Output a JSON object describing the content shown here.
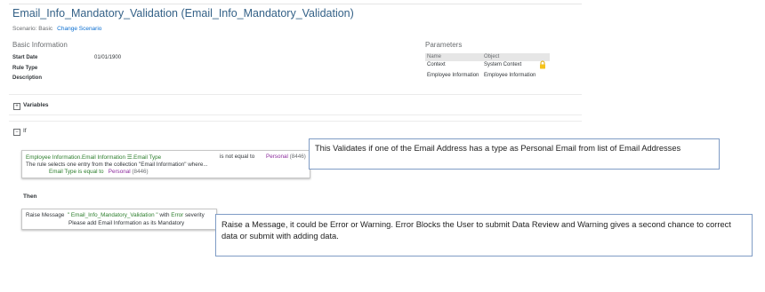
{
  "header": {
    "title": "Email_Info_Mandatory_Validation (Email_Info_Mandatory_Validation)",
    "scenario_label": "Scenario: Basic",
    "change_scenario": "Change Scenario"
  },
  "basic_info": {
    "heading": "Basic Information",
    "fields": [
      {
        "label": "Start Date",
        "value": "01/01/1900"
      },
      {
        "label": "Rule Type",
        "value": ""
      },
      {
        "label": "Description",
        "value": ""
      }
    ]
  },
  "parameters": {
    "heading": "Parameters",
    "columns": [
      "Name",
      "Object"
    ],
    "rows": [
      {
        "name": "Context",
        "object": "System Context",
        "icon": "lock-icon"
      },
      {
        "name": "Employee Information",
        "object": "Employee Information"
      }
    ]
  },
  "variables": {
    "toggle": "+",
    "label": "Variables"
  },
  "if_section": {
    "toggle": "−",
    "label": "If",
    "condition": {
      "field": "Employee Information.Email Information ☰.Email Type",
      "operator": "is not equal to",
      "value": "Personal",
      "value_id": "(8446)",
      "description": "The rule selects one entry from the collection \"Email Information\" where...",
      "sub_field": "Email Type is equal to",
      "sub_value": "Personal",
      "sub_value_id": "(8446)"
    }
  },
  "then_section": {
    "label": "Then",
    "action": "Raise Message",
    "message_name": "\" Email_Info_Mandatory_Validation \"",
    "with_text": "with",
    "severity": "Error",
    "severity_suffix": "severity",
    "message_text": "Please add Email Information as its Mandatory"
  },
  "annotations": {
    "note1": "This Validates if one of the Email Address has a type as Personal Email from list of Email Addresses",
    "note2": "Raise a Message, it could be Error or Warning. Error Blocks the User to submit Data Review and Warning gives a second chance to correct data or submit with adding data."
  },
  "colors": {
    "title": "#346187",
    "link": "#0a6ed1",
    "field_green": "#2b7d2b",
    "value_purple": "#8b2a9c",
    "note_border": "#7f9cc5"
  }
}
